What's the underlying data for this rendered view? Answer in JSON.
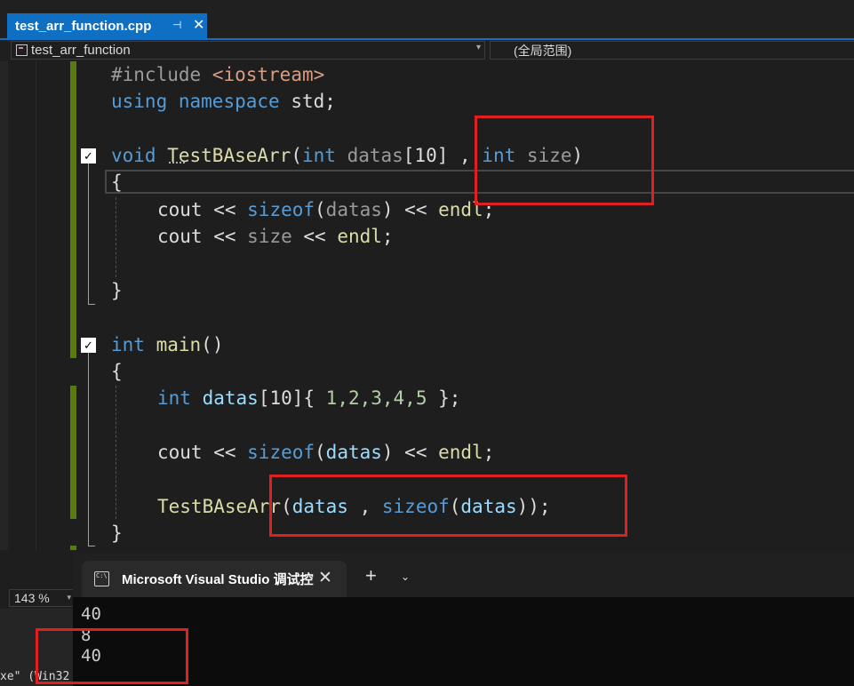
{
  "tabs": [
    {
      "title": "test_arr_function.cpp",
      "pin_icon": "⊣",
      "close_icon": "✕"
    }
  ],
  "navbar": {
    "project": "test_arr_function",
    "scope": "(全局范围)"
  },
  "code": {
    "line1_kw": "#include",
    "line1_header": "<iostream>",
    "line2_using": "using",
    "line2_namespace": "namespace",
    "line2_std": "std;",
    "line4_void": "void",
    "line4_fn": "TestBAseArr",
    "line4_open": "(",
    "line4_int1": "int",
    "line4_p1": "datas",
    "line4_arr": "[10] , ",
    "line4_int2": "int",
    "line4_p2": "size",
    "line4_close": ")",
    "line5_brace": "{",
    "line6_cout": "cout << ",
    "line6_sizeof": "sizeof",
    "line6_open": "(",
    "line6_datas": "datas",
    "line6_rest": ") << ",
    "line6_endl": "endl",
    "line6_semi": ";",
    "line7_cout": "cout << ",
    "line7_size": "size",
    "line7_mid": " << ",
    "line7_endl": "endl",
    "line7_semi": ";",
    "line9_brace": "}",
    "line11_int": "int",
    "line11_main": "main",
    "line11_parens": "()",
    "line12_brace": "{",
    "line13_int": "int",
    "line13_datas": "datas",
    "line13_rest": "[10]{ ",
    "line13_nums": "1,2,3,4,5",
    "line13_end": " };",
    "line15_cout": "cout << ",
    "line15_sizeof": "sizeof",
    "line15_open": "(",
    "line15_datas": "datas",
    "line15_rest": ") << ",
    "line15_endl": "endl",
    "line15_semi": ";",
    "line17_fn": "TestBAseArr",
    "line17_open": "(",
    "line17_datas": "datas",
    "line17_comma": " , ",
    "line17_sizeof": "sizeof",
    "line17_open2": "(",
    "line17_datas2": "datas",
    "line17_end": "));",
    "line18_brace": "}"
  },
  "status": {
    "zoom": "143 %"
  },
  "output_pane": {
    "snippet": "xe\" (Win32"
  },
  "terminal": {
    "tab_title": "Microsoft Visual Studio 调试控",
    "tab_icon_text": "C:\\",
    "close_icon": "✕",
    "new_tab_icon": "+",
    "dropdown_icon": "⌄",
    "output_lines": [
      "40",
      "8",
      "40"
    ]
  },
  "colors": {
    "accent": "#0e6fc3",
    "annotation": "#e02020",
    "change_bar": "#587c0c"
  }
}
